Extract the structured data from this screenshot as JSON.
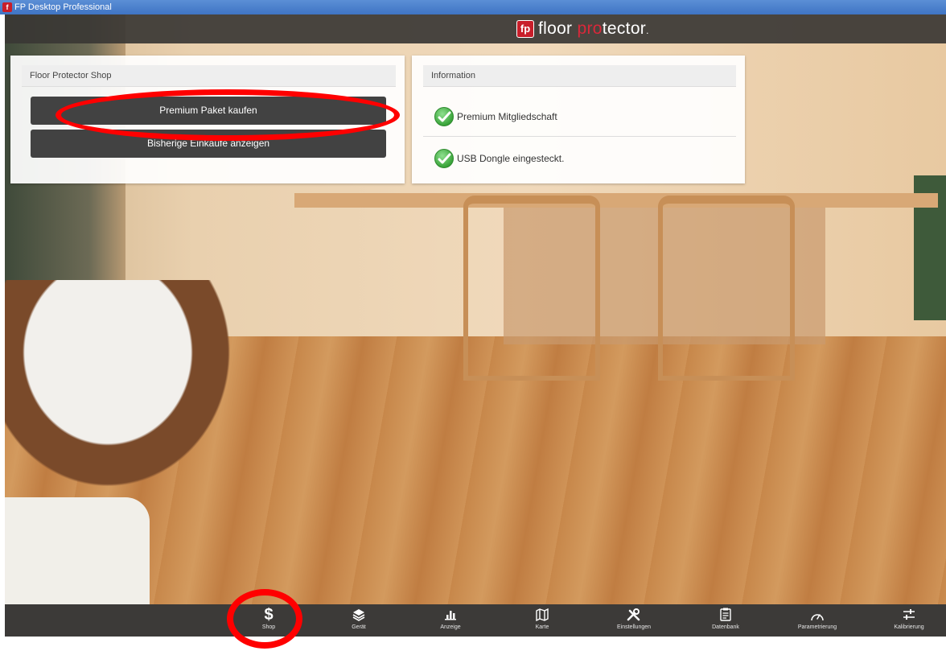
{
  "window": {
    "title": "FP Desktop Professional",
    "icon_letter": "f"
  },
  "brand": {
    "mark": "fp",
    "text_part1": "floor ",
    "text_accent": "pro",
    "text_part2": "tector",
    "suffix": "."
  },
  "shop_panel": {
    "title": "Floor Protector Shop",
    "buy_button": "Premium Paket kaufen",
    "history_button": "Bisherige Einkäufe anzeigen"
  },
  "info_panel": {
    "title": "Information",
    "items": [
      {
        "label": "Premium Mitgliedschaft",
        "icon": "check-circle-icon"
      },
      {
        "label": "USB Dongle eingesteckt.",
        "icon": "check-circle-icon"
      }
    ]
  },
  "nav": {
    "items": [
      {
        "label": "Shop",
        "icon": "dollar-icon"
      },
      {
        "label": "Gerät",
        "icon": "layers-icon"
      },
      {
        "label": "Anzeige",
        "icon": "bar-chart-icon"
      },
      {
        "label": "Karte",
        "icon": "map-icon"
      },
      {
        "label": "Einstellungen",
        "icon": "tools-icon"
      },
      {
        "label": "Datenbank",
        "icon": "clipboard-icon"
      },
      {
        "label": "Parametrierung",
        "icon": "gauge-icon"
      },
      {
        "label": "Kalibrierung",
        "icon": "sliders-icon"
      }
    ]
  },
  "colors": {
    "accent_red": "#c81e2a",
    "button_dark": "#424242",
    "nav_bg": "#3c3a38",
    "annotation": "#ff0000"
  }
}
